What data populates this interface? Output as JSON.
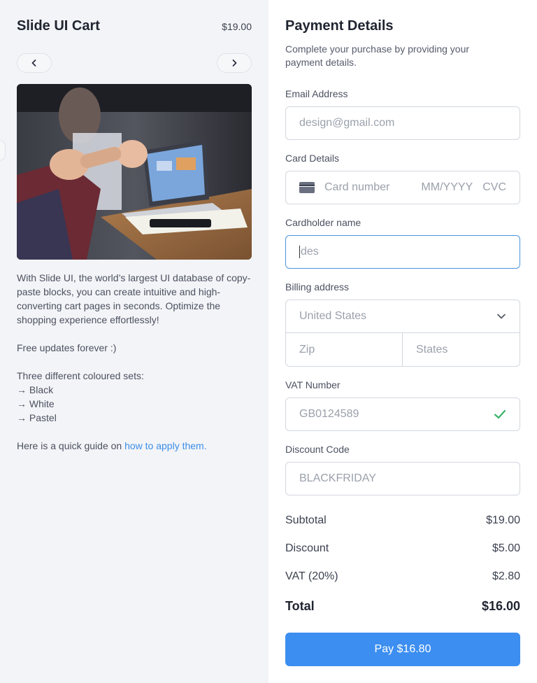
{
  "cart": {
    "title": "Slide UI Cart",
    "price": "$19.00",
    "nav_prev_icon": "chevron-left-icon",
    "nav_next_icon": "chevron-right-icon",
    "description": {
      "intro": "With Slide UI, the world’s largest UI database of copy-paste blocks, you can create intuitive and high-converting cart pages in seconds. Optimize the shopping experience effortlessly!",
      "updates": "Free updates forever :)",
      "sets_heading": "Three different coloured sets:",
      "sets": [
        "→ Black",
        "→ White",
        "→ Pastel"
      ],
      "guide_prefix": "Here is a quick guide on ",
      "guide_link": "how to apply them."
    }
  },
  "payment": {
    "title": "Payment Details",
    "subtitle": "Complete your purchase by providing your payment details.",
    "email": {
      "label": "Email Address",
      "placeholder": "design@gmail.com"
    },
    "card": {
      "label": "Card Details",
      "icon": "credit-card-icon",
      "number_placeholder": "Card number",
      "expiry_placeholder": "MM/YYYY",
      "cvc_placeholder": "CVC"
    },
    "cardholder": {
      "label": "Cardholder name",
      "value": "des"
    },
    "billing": {
      "label": "Billing address",
      "country": "United States",
      "zip_placeholder": "Zip",
      "state_placeholder": "States"
    },
    "vat": {
      "label": "VAT Number",
      "value": "GB0124589",
      "status_icon": "check-icon"
    },
    "discount": {
      "label": "Discount Code",
      "value": "BLACKFRIDAY"
    },
    "summary": {
      "subtotal_label": "Subtotal",
      "subtotal_value": "$19.00",
      "discount_label": "Discount",
      "discount_value": "$5.00",
      "vat_label": "VAT (20%)",
      "vat_value": "$2.80",
      "total_label": "Total",
      "total_value": "$16.00"
    },
    "pay_button": "Pay $16.80"
  },
  "colors": {
    "accent": "#3c8ef0",
    "link": "#3b8ee8",
    "success": "#3bb36b",
    "left_panel_bg": "#f3f4f7"
  }
}
